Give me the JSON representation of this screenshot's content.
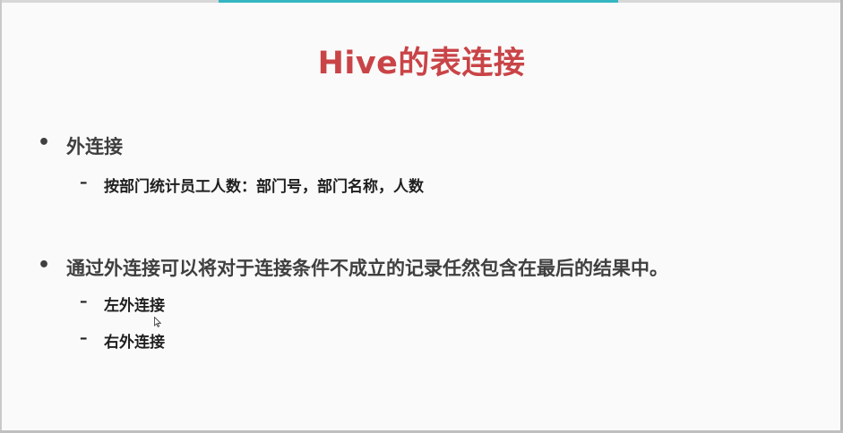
{
  "slide": {
    "title": "Hive的表连接",
    "bullets": [
      {
        "marker": "•",
        "text": "外连接",
        "subitems": [
          {
            "marker": "–",
            "text": "按部门统计员工人数：部门号，部门名称，人数"
          }
        ]
      },
      {
        "marker": "•",
        "text": "通过外连接可以将对于连接条件不成立的记录任然包含在最后的结果中。",
        "subitems": [
          {
            "marker": "–",
            "text": "左外连接"
          },
          {
            "marker": "–",
            "text": "右外连接"
          }
        ]
      }
    ]
  },
  "colors": {
    "title": "#c94447",
    "body_text": "#3f3f3f",
    "accent_bar": "#35b6c2",
    "background": "#fafafa"
  },
  "icons": {
    "cursor": "mouse-pointer-icon"
  }
}
